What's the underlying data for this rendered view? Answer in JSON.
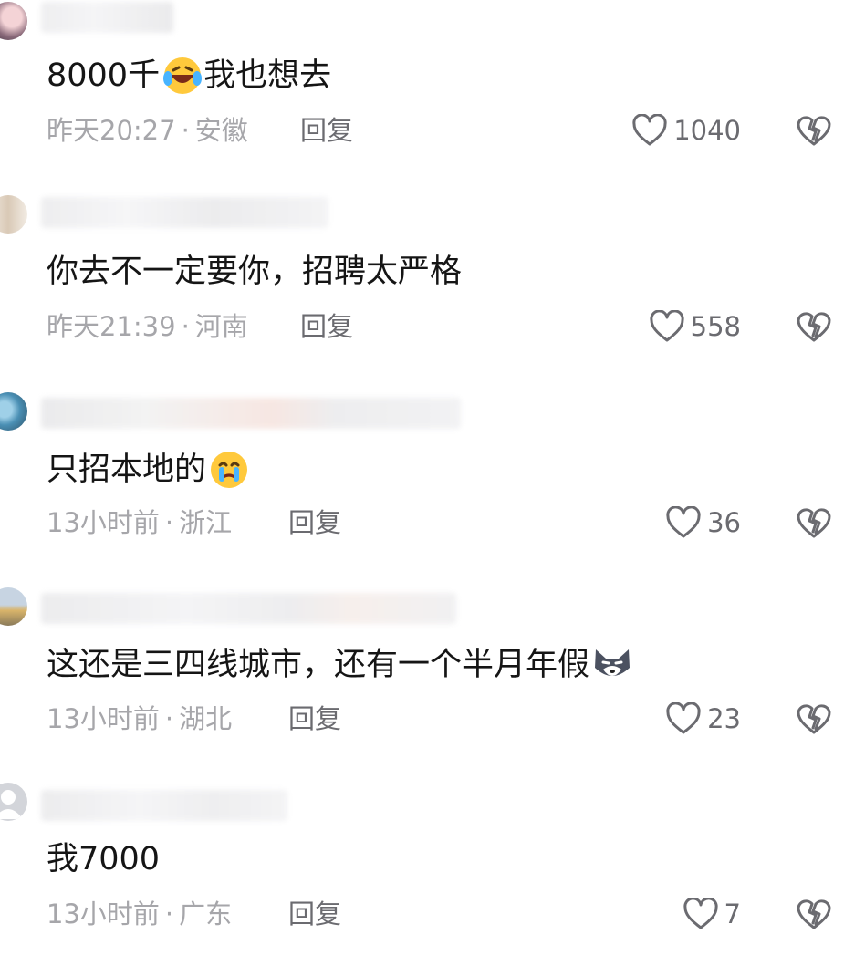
{
  "comments": [
    {
      "text": "8000千",
      "text_after_emoji": "我也想去",
      "emoji_1": "laughing-crying-emoji",
      "time": "昨天20:27",
      "location": "安徽",
      "reply_label": "回复",
      "likes": "1040"
    },
    {
      "text": "你去不一定要你，招聘太严格",
      "time": "昨天21:39",
      "location": "河南",
      "reply_label": "回复",
      "likes": "558"
    },
    {
      "text": "只招本地的",
      "emoji_1": "crying-emoji",
      "time": "13小时前",
      "location": "浙江",
      "reply_label": "回复",
      "likes": "36"
    },
    {
      "text": "这还是三四线城市，还有一个半月年假",
      "emoji_1": "husky-dog-emoji",
      "time": "13小时前",
      "location": "湖北",
      "reply_label": "回复",
      "likes": "23"
    },
    {
      "text": "我7000",
      "time": "13小时前",
      "location": "广东",
      "reply_label": "回复",
      "likes": "7"
    }
  ],
  "meta_separator": "·",
  "colors": {
    "text": "#151515",
    "meta": "#a6a6aa",
    "action": "#6b6b70"
  }
}
